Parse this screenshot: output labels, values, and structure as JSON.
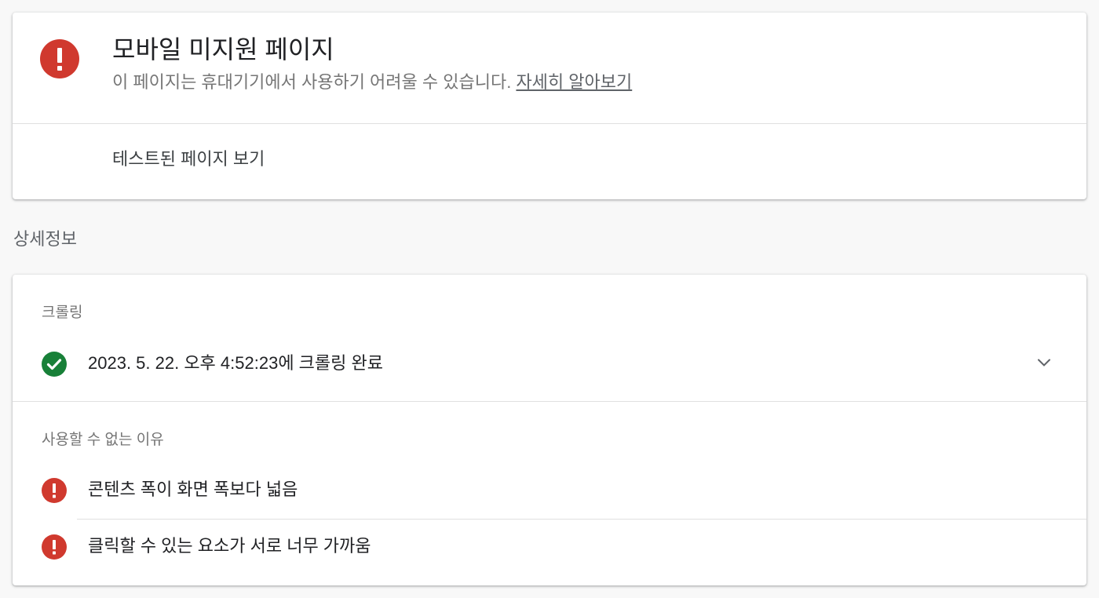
{
  "status": {
    "title": "모바일 미지원 페이지",
    "description": "이 페이지는 휴대기기에서 사용하기 어려울 수 있습니다.",
    "learn_more": "자세히 알아보기",
    "view_tested_page": "테스트된 페이지 보기",
    "icon": "error-icon"
  },
  "details": {
    "heading": "상세정보",
    "crawl_label": "크롤링",
    "crawl_status": "2023. 5. 22. 오후 4:52:23에 크롤링 완료",
    "crawl_icon": "check-circle-icon",
    "unusable_label": "사용할 수 없는 이유",
    "issues": [
      {
        "text": "콘텐츠 폭이 화면 폭보다 넓음",
        "icon": "error-icon"
      },
      {
        "text": "클릭할 수 있는 요소가 서로 너무 가까움",
        "icon": "error-icon"
      }
    ]
  },
  "colors": {
    "error": "#c5221f",
    "success": "#188038",
    "background": "#f8f8f8"
  }
}
